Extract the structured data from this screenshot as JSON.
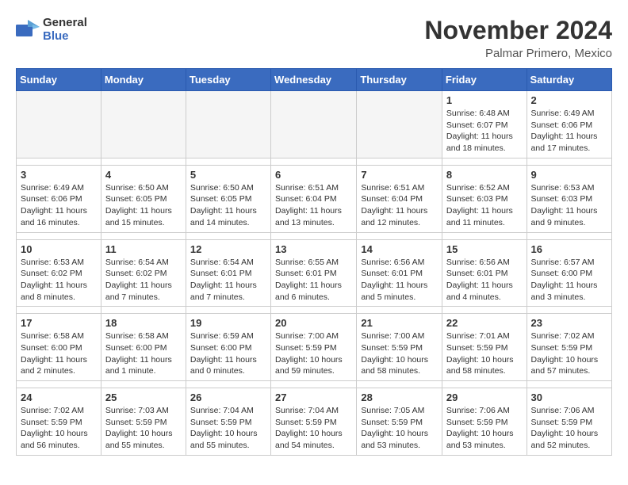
{
  "logo": {
    "line1": "General",
    "line2": "Blue"
  },
  "title": "November 2024",
  "subtitle": "Palmar Primero, Mexico",
  "days_of_week": [
    "Sunday",
    "Monday",
    "Tuesday",
    "Wednesday",
    "Thursday",
    "Friday",
    "Saturday"
  ],
  "weeks": [
    {
      "cells": [
        {
          "day": "",
          "info": ""
        },
        {
          "day": "",
          "info": ""
        },
        {
          "day": "",
          "info": ""
        },
        {
          "day": "",
          "info": ""
        },
        {
          "day": "",
          "info": ""
        },
        {
          "day": "1",
          "info": "Sunrise: 6:48 AM\nSunset: 6:07 PM\nDaylight: 11 hours\nand 18 minutes."
        },
        {
          "day": "2",
          "info": "Sunrise: 6:49 AM\nSunset: 6:06 PM\nDaylight: 11 hours\nand 17 minutes."
        }
      ]
    },
    {
      "cells": [
        {
          "day": "3",
          "info": "Sunrise: 6:49 AM\nSunset: 6:06 PM\nDaylight: 11 hours\nand 16 minutes."
        },
        {
          "day": "4",
          "info": "Sunrise: 6:50 AM\nSunset: 6:05 PM\nDaylight: 11 hours\nand 15 minutes."
        },
        {
          "day": "5",
          "info": "Sunrise: 6:50 AM\nSunset: 6:05 PM\nDaylight: 11 hours\nand 14 minutes."
        },
        {
          "day": "6",
          "info": "Sunrise: 6:51 AM\nSunset: 6:04 PM\nDaylight: 11 hours\nand 13 minutes."
        },
        {
          "day": "7",
          "info": "Sunrise: 6:51 AM\nSunset: 6:04 PM\nDaylight: 11 hours\nand 12 minutes."
        },
        {
          "day": "8",
          "info": "Sunrise: 6:52 AM\nSunset: 6:03 PM\nDaylight: 11 hours\nand 11 minutes."
        },
        {
          "day": "9",
          "info": "Sunrise: 6:53 AM\nSunset: 6:03 PM\nDaylight: 11 hours\nand 9 minutes."
        }
      ]
    },
    {
      "cells": [
        {
          "day": "10",
          "info": "Sunrise: 6:53 AM\nSunset: 6:02 PM\nDaylight: 11 hours\nand 8 minutes."
        },
        {
          "day": "11",
          "info": "Sunrise: 6:54 AM\nSunset: 6:02 PM\nDaylight: 11 hours\nand 7 minutes."
        },
        {
          "day": "12",
          "info": "Sunrise: 6:54 AM\nSunset: 6:01 PM\nDaylight: 11 hours\nand 7 minutes."
        },
        {
          "day": "13",
          "info": "Sunrise: 6:55 AM\nSunset: 6:01 PM\nDaylight: 11 hours\nand 6 minutes."
        },
        {
          "day": "14",
          "info": "Sunrise: 6:56 AM\nSunset: 6:01 PM\nDaylight: 11 hours\nand 5 minutes."
        },
        {
          "day": "15",
          "info": "Sunrise: 6:56 AM\nSunset: 6:01 PM\nDaylight: 11 hours\nand 4 minutes."
        },
        {
          "day": "16",
          "info": "Sunrise: 6:57 AM\nSunset: 6:00 PM\nDaylight: 11 hours\nand 3 minutes."
        }
      ]
    },
    {
      "cells": [
        {
          "day": "17",
          "info": "Sunrise: 6:58 AM\nSunset: 6:00 PM\nDaylight: 11 hours\nand 2 minutes."
        },
        {
          "day": "18",
          "info": "Sunrise: 6:58 AM\nSunset: 6:00 PM\nDaylight: 11 hours\nand 1 minute."
        },
        {
          "day": "19",
          "info": "Sunrise: 6:59 AM\nSunset: 6:00 PM\nDaylight: 11 hours\nand 0 minutes."
        },
        {
          "day": "20",
          "info": "Sunrise: 7:00 AM\nSunset: 5:59 PM\nDaylight: 10 hours\nand 59 minutes."
        },
        {
          "day": "21",
          "info": "Sunrise: 7:00 AM\nSunset: 5:59 PM\nDaylight: 10 hours\nand 58 minutes."
        },
        {
          "day": "22",
          "info": "Sunrise: 7:01 AM\nSunset: 5:59 PM\nDaylight: 10 hours\nand 58 minutes."
        },
        {
          "day": "23",
          "info": "Sunrise: 7:02 AM\nSunset: 5:59 PM\nDaylight: 10 hours\nand 57 minutes."
        }
      ]
    },
    {
      "cells": [
        {
          "day": "24",
          "info": "Sunrise: 7:02 AM\nSunset: 5:59 PM\nDaylight: 10 hours\nand 56 minutes."
        },
        {
          "day": "25",
          "info": "Sunrise: 7:03 AM\nSunset: 5:59 PM\nDaylight: 10 hours\nand 55 minutes."
        },
        {
          "day": "26",
          "info": "Sunrise: 7:04 AM\nSunset: 5:59 PM\nDaylight: 10 hours\nand 55 minutes."
        },
        {
          "day": "27",
          "info": "Sunrise: 7:04 AM\nSunset: 5:59 PM\nDaylight: 10 hours\nand 54 minutes."
        },
        {
          "day": "28",
          "info": "Sunrise: 7:05 AM\nSunset: 5:59 PM\nDaylight: 10 hours\nand 53 minutes."
        },
        {
          "day": "29",
          "info": "Sunrise: 7:06 AM\nSunset: 5:59 PM\nDaylight: 10 hours\nand 53 minutes."
        },
        {
          "day": "30",
          "info": "Sunrise: 7:06 AM\nSunset: 5:59 PM\nDaylight: 10 hours\nand 52 minutes."
        }
      ]
    }
  ]
}
